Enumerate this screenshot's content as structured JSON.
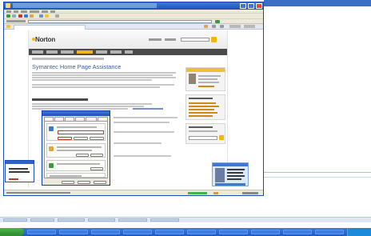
{
  "window": {
    "title": "",
    "menu_items": [],
    "address": ""
  },
  "page": {
    "logo": "Norton",
    "title": "Symantec Home Page Assistance"
  },
  "dialog": {
    "title": "",
    "home_page_url": ""
  },
  "taskbar": {
    "start_label": "",
    "items": []
  },
  "icons": {
    "page": "ie-page-icon",
    "favorites": "star-icon",
    "go": "go-arrow-icon",
    "search": "search-icon",
    "close": "close-icon"
  },
  "colors": {
    "title_bar": "#1f52b8",
    "accent": "#f3b80e",
    "page_title": "#3a5f9a",
    "highlight_box": "#c0392b",
    "taskbar": "#3a7ae0",
    "start_button": "#3f9a3f"
  }
}
